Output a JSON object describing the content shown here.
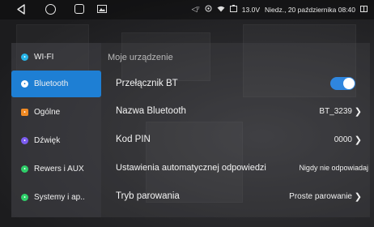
{
  "statusbar": {
    "gallery_icon": "image-icon",
    "volume": "◁⁷",
    "voltage": "13.0V",
    "datetime": "Niedz., 20 października 08:40"
  },
  "sidebar": {
    "items": [
      {
        "label": "WI-FI",
        "icon": "wifi-icon",
        "color": "#27b5e8",
        "active": false
      },
      {
        "label": "Bluetooth",
        "icon": "bluetooth-icon",
        "color": "#ffffff",
        "active": true
      },
      {
        "label": "Ogólne",
        "icon": "general-icon",
        "color": "#f08a24",
        "active": false
      },
      {
        "label": "Dźwięk",
        "icon": "sound-icon",
        "color": "#7b5cf0",
        "active": false
      },
      {
        "label": "Rewers i AUX",
        "icon": "reverse-icon",
        "color": "#2fcf6a",
        "active": false
      },
      {
        "label": "Systemy i ap..",
        "icon": "system-icon",
        "color": "#2fcf6a",
        "active": false
      }
    ]
  },
  "main": {
    "section_title": "Moje urządzenie",
    "rows": [
      {
        "label": "Przełącznik BT",
        "type": "toggle",
        "on": true
      },
      {
        "label": "Nazwa Bluetooth",
        "value": "BT_3239"
      },
      {
        "label": "Kod PIN",
        "value": "0000"
      },
      {
        "label": "Ustawienia automatycznej odpowiedzi",
        "value": "Nigdy nie odpowiadaj"
      },
      {
        "label": "Tryb parowania",
        "value": "Proste parowanie"
      }
    ]
  },
  "colors": {
    "accent": "#1e7fd4",
    "toggle_on": "#2f86de"
  }
}
